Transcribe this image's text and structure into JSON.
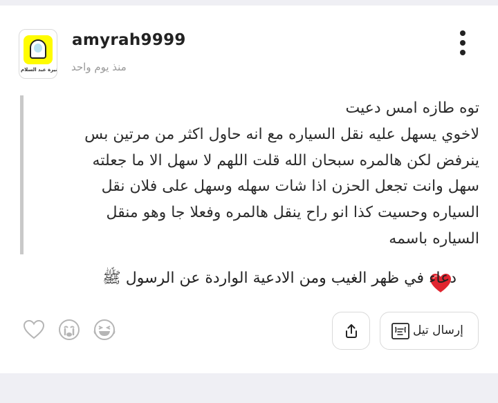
{
  "post": {
    "username": "amyrah9999",
    "time": "منذ يوم واحد",
    "avatar_caption": "منيرة عبد السلام"
  },
  "quote_lines": [
    "توه طازه امس دعيت",
    "لاخوي يسهل عليه نقل السياره مع انه حاول اكثر من مرتين بس",
    "ينرفض لكن هالمره سبحان الله قلت اللهم لا سهل الا ما جعلته",
    "سهل وانت تجعل الحزن اذا شات سهله وسهل على فلان نقل",
    "السياره وحسيت كذا انو راح ينقل هالمره وفعلا جا وهو منقل",
    "السياره باسمه"
  ],
  "dua_text": "دعاء  في ظهر الغيب ومن الادعية الواردة عن الرسول ﷺ",
  "actions": {
    "send_label": "إرسال تيل"
  },
  "icons": {
    "more": "more-vertical-icon",
    "heart": "red-heart-emoji",
    "like": "heart-outline-icon",
    "cry": "crying-face-icon",
    "laugh": "laughing-face-icon",
    "share": "share-icon",
    "send": "tell-card-icon"
  },
  "colors": {
    "heart": "#e0242f",
    "text": "#222222",
    "muted": "#999999",
    "quote_bar": "#c9c9c9"
  }
}
